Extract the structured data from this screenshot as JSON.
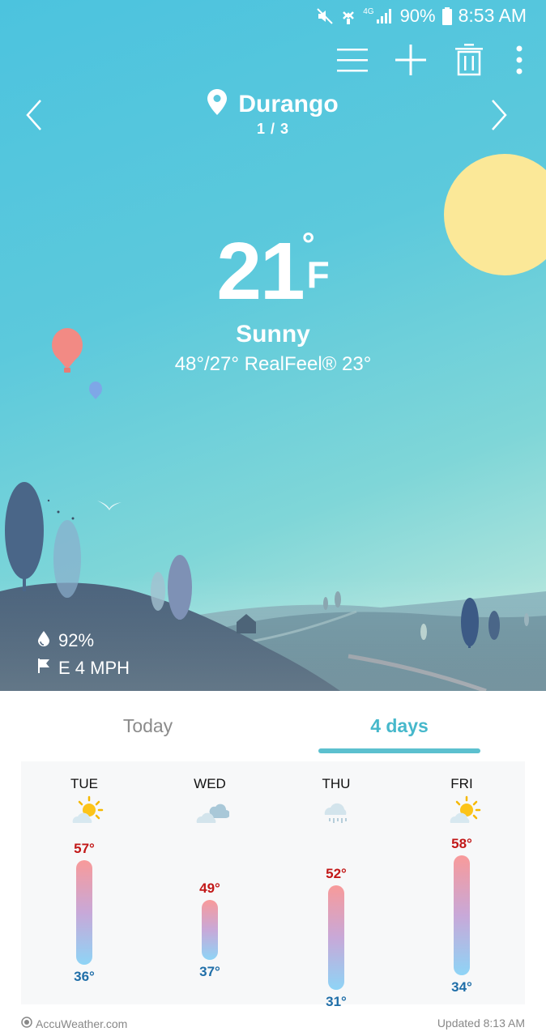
{
  "status_bar": {
    "battery": "90%",
    "time": "8:53 AM",
    "network": "4G"
  },
  "toolbar": {
    "icons": [
      "menu-icon",
      "add-icon",
      "trash-icon",
      "more-icon"
    ]
  },
  "location": {
    "city": "Durango",
    "page": "1 / 3"
  },
  "current": {
    "temp": "21",
    "unit": "F",
    "degree": "°",
    "condition": "Sunny",
    "hilo": "48°/27° RealFeel® 23°",
    "humidity": "92%",
    "wind": "E 4 MPH"
  },
  "tabs": {
    "today": "Today",
    "days": "4 days",
    "selected": "4 days"
  },
  "forecast": {
    "days": [
      {
        "name": "TUE",
        "hi": "57°",
        "lo": "36°",
        "hi_value": 57,
        "lo_value": 36,
        "icon": "partly-sunny-icon"
      },
      {
        "name": "WED",
        "hi": "49°",
        "lo": "37°",
        "hi_value": 49,
        "lo_value": 37,
        "icon": "cloudy-icon"
      },
      {
        "name": "THU",
        "hi": "52°",
        "lo": "31°",
        "hi_value": 52,
        "lo_value": 31,
        "icon": "rain-icon"
      },
      {
        "name": "FRI",
        "hi": "58°",
        "lo": "34°",
        "hi_value": 58,
        "lo_value": 34,
        "icon": "partly-sunny-icon"
      }
    ]
  },
  "footer": {
    "brand": "AccuWeather.com",
    "updated": "Updated 8:13 AM"
  },
  "colors": {
    "sky_top": "#4cc3de",
    "sun": "#fbe898",
    "accent": "#46b8cb",
    "high_temp": "#c21818",
    "low_temp": "#1f6ea8"
  }
}
